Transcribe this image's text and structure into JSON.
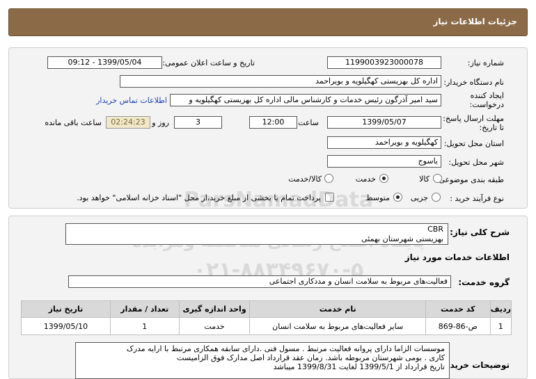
{
  "title": "جزئیات اطلاعات نیاز",
  "fields": {
    "need_number_label": "شماره نیاز:",
    "need_number": "1199003923000078",
    "announce_label": "تاریخ و ساعت اعلان عمومی:",
    "announce_value": "1399/05/04 - 09:12",
    "buyer_label": "نام دستگاه خریدار:",
    "buyer_value": "اداره کل بهزیستی کهگیلویه و بویراحمد",
    "creator_label_1": "ایجاد کننده",
    "creator_label_2": "درخواست:",
    "creator_value": "سید امیر آذرگون رئیس خدمات و کارشناس مالی اداره کل بهزیستی کهگیلویه و",
    "contact_link": "اطلاعات تماس خریدار",
    "deadline_label_1": "مهلت ارسال پاسخ:",
    "deadline_label_2": "تا تاریخ:",
    "deadline_date": "1399/05/07",
    "time_label": "ساعت",
    "deadline_time": "12:00",
    "days_value": "3",
    "days_label": "روز و",
    "remaining_time": "02:24:23",
    "remaining_label": "ساعت باقی مانده",
    "province_label": "استان محل تحویل:",
    "province_value": "کهگیلویه و بویراحمد",
    "city_label": "شهر محل تحویل:",
    "city_value": "یاسوج",
    "category_label": "طبقه بندی موضوعی:",
    "category_options": [
      "کالا",
      "خدمت",
      "کالا/خدمت"
    ],
    "category_selected": "خدمت",
    "process_label": "نوع فرآیند خرید :",
    "process_options": [
      "جزیی",
      "متوسط"
    ],
    "process_selected": "متوسط",
    "payment_note": "پرداخت تمام یا بخشی از مبلغ خرید،از محل \"اسناد خزانه اسلامی\" خواهد بود."
  },
  "need_summary": {
    "label": "شرح کلی نیاز:",
    "line1": "CBR",
    "line2": "بهزیستی شهرستان بهمئی"
  },
  "services_heading": "اطلاعات خدمات مورد نیاز",
  "service_group": {
    "label": "گروه خدمت:",
    "value": "فعالیت‌های مربوط به سلامت انسان و مددکاری اجتماعی"
  },
  "table": {
    "headers": [
      "ردیف",
      "کد خدمت",
      "نام خدمت",
      "واحد اندازه گیری",
      "تعداد / مقدار",
      "تاریخ نیاز"
    ],
    "rows": [
      [
        "1",
        "ص-86-869",
        "سایر فعالیت‌های مربوط به سلامت انسان",
        "خدمت",
        "1",
        "1399/05/10"
      ]
    ]
  },
  "buyer_notes": {
    "label": "توضیحات خریدار:",
    "line1": "موسسات الزاما دارای پروانه فعالیت مرتبط .  مسول فنی  .دارای سابقه همکاری مرتبط با ارایه مدرک",
    "line2": "کاری  . بومی شهرستان مربوطه باشد. زمان عقد قرارداد اصل مدارک فوق الزامیست",
    "line3": "تاریخ قرارداد از 1399/5/1  لغایت  1399/8/31  میباشد"
  },
  "watermark": {
    "line1": "ParsNamadData",
    "line2": "پایگاه اطلاع رسانی مناقصه ومزایده",
    "line3": "۰۲۱-۸۸۳۴۹۶۷۰-۵"
  }
}
